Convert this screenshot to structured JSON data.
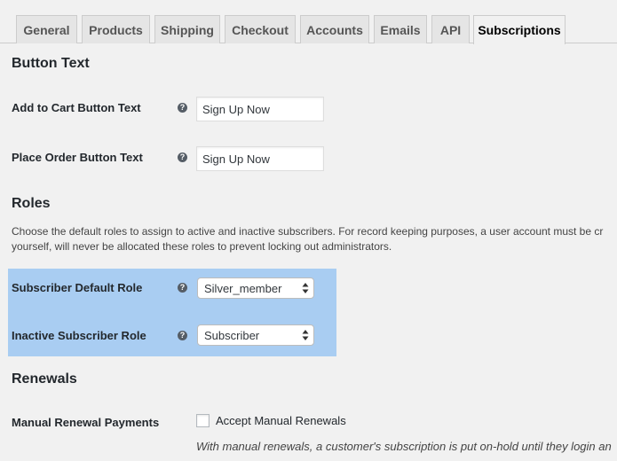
{
  "tabs": [
    {
      "label": "General",
      "active": false
    },
    {
      "label": "Products",
      "active": false
    },
    {
      "label": "Shipping",
      "active": false
    },
    {
      "label": "Checkout",
      "active": false
    },
    {
      "label": "Accounts",
      "active": false
    },
    {
      "label": "Emails",
      "active": false
    },
    {
      "label": "API",
      "active": false
    },
    {
      "label": "Subscriptions",
      "active": true
    }
  ],
  "button_text": {
    "heading": "Button Text",
    "add_to_cart": {
      "label": "Add to Cart Button Text",
      "value": "Sign Up Now"
    },
    "place_order": {
      "label": "Place Order Button Text",
      "value": "Sign Up Now"
    }
  },
  "roles": {
    "heading": "Roles",
    "description_line1": "Choose the default roles to assign to active and inactive subscribers. For record keeping purposes, a user account must be cr",
    "description_line2": "yourself, will never be allocated these roles to prevent locking out administrators.",
    "default_role": {
      "label": "Subscriber Default Role",
      "value": "Silver_member"
    },
    "inactive_role": {
      "label": "Inactive Subscriber Role",
      "value": "Subscriber"
    },
    "highlight_color": "#a9cdf2"
  },
  "renewals": {
    "heading": "Renewals",
    "manual_label": "Manual Renewal Payments",
    "checkbox_label": "Accept Manual Renewals",
    "checkbox_checked": false,
    "description": "With manual renewals, a customer's subscription is put on-hold until they login an"
  },
  "help_icon": "question-mark-icon",
  "help_glyph": "?"
}
